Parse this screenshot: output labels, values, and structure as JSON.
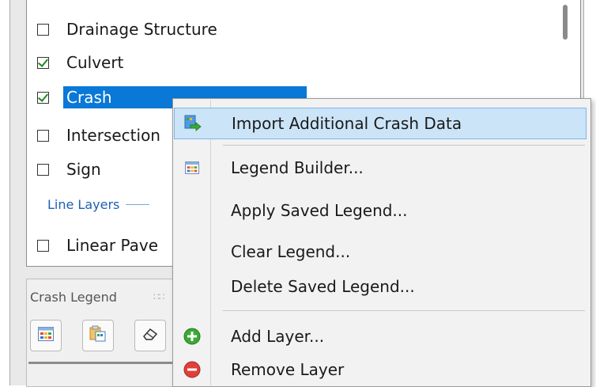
{
  "layers": {
    "items": [
      {
        "label": "Drainage Structure",
        "checked": false
      },
      {
        "label": "Culvert",
        "checked": true
      },
      {
        "label": "Crash",
        "checked": true,
        "selected": true
      },
      {
        "label": "Intersection",
        "checked": false
      },
      {
        "label": "Sign",
        "checked": false
      }
    ],
    "group_line_layers": "Line Layers",
    "linear_item": {
      "label": "Linear Pave",
      "checked": false
    }
  },
  "legend_panel": {
    "title": "Crash Legend",
    "tools": [
      "legend-grid-icon",
      "legend-folder-icon",
      "eraser-icon"
    ]
  },
  "context_menu": {
    "items": [
      {
        "label": "Import Additional Crash Data",
        "icon": "import-arrow-icon",
        "highlighted": true
      },
      {
        "label": "Legend Builder...",
        "icon": "legend-grid-icon"
      },
      {
        "label": "Apply Saved Legend..."
      },
      {
        "label": "Clear Legend..."
      },
      {
        "label": "Delete Saved Legend..."
      },
      {
        "label": "Add Layer...",
        "icon": "add-circle-icon"
      },
      {
        "label": "Remove Layer",
        "icon": "remove-circle-icon"
      }
    ]
  },
  "colors": {
    "selection": "#0a78d7",
    "menu_highlight": "#cbe4f8",
    "group_label": "#1e5fb5",
    "check": "#1e8a1e",
    "add_green": "#3aa935",
    "remove_red": "#e0403a"
  }
}
